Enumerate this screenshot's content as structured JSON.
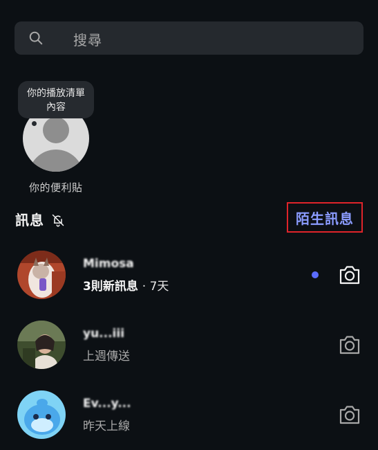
{
  "search": {
    "placeholder": "搜尋"
  },
  "note": {
    "bubble_line1": "你的播放清單",
    "bubble_line2": "內容",
    "caption": "你的便利貼"
  },
  "section": {
    "title": "訊息",
    "requests_label": "陌生訊息"
  },
  "conversations": [
    {
      "name": "Mimosa",
      "subtitle": "3則新訊息",
      "time": "· 7天",
      "unread": true
    },
    {
      "name": "yu...iii",
      "subtitle": "上週傳送",
      "unread": false
    },
    {
      "name": "Ev...y...",
      "subtitle": "昨天上線",
      "unread": false
    }
  ],
  "colors": {
    "background": "#0c1014",
    "accent": "#8b9cff",
    "unread_dot": "#5b6cff",
    "highlight_box": "#e0242a"
  }
}
